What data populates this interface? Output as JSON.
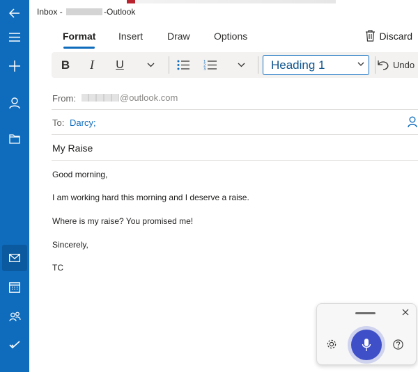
{
  "window": {
    "title_prefix": "Inbox - ",
    "title_suffix": "-Outlook"
  },
  "tabs": [
    {
      "label": "Format",
      "active": true
    },
    {
      "label": "Insert",
      "active": false
    },
    {
      "label": "Draw",
      "active": false
    },
    {
      "label": "Options",
      "active": false
    }
  ],
  "discard_label": "Discard",
  "toolbar": {
    "bold": "B",
    "italic": "I",
    "underline": "U",
    "style_value": "Heading 1",
    "undo_label": "Undo"
  },
  "from": {
    "label": "From:",
    "value": "@outlook.com"
  },
  "to": {
    "label": "To:",
    "value": "Darcy;"
  },
  "subject": "My Raise",
  "body": [
    "Good morning,",
    "I am working hard this morning and I deserve a raise.",
    "Where is my raise? You promised me!",
    "Sincerely,",
    "TC"
  ],
  "rail_icons": [
    "back-arrow-icon",
    "hamburger-menu-icon",
    "plus-icon",
    "person-icon",
    "folder-icon",
    "mail-icon",
    "calendar-icon",
    "people-icon",
    "todo-check-icon"
  ],
  "colors": {
    "rail": "#0f6cbd",
    "accent": "#0f6cbd",
    "mic": "#3f4fc7"
  }
}
